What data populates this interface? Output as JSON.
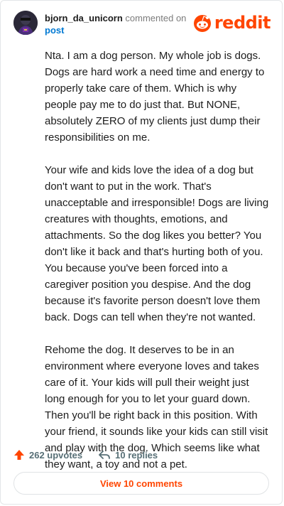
{
  "header": {
    "username": "bjorn_da_unicorn",
    "commented_text": "commented on",
    "post_link": "post",
    "logo_text": "reddit",
    "brand_color": "#ff4500",
    "link_color": "#0079d3"
  },
  "comment": {
    "paragraphs": [
      "Nta. I am a dog person. My whole job is dogs. Dogs are hard work a need time and energy to properly take care of them. Which is why people pay me to do just that. But NONE, absolutely ZERO of my clients just dump their responsibilities on me.",
      "Your wife and kids love the idea of a dog but don't want to put in the work. That's unacceptable and irresponsible! Dogs are living creatures with thoughts, emotions, and attachments. So the dog likes you better? You don't like it back and that's hurting both of you. You because you've been forced into a caregiver position you despise. And the dog because it's favorite person doesn't love them back. Dogs can tell when they're not wanted.",
      "Rehome the dog. It deserves to be in an environment where everyone loves and takes care of it. Your kids will pull their weight just long enough for you to let your guard down. Then you'll be right back in this position. With your friend, it sounds like your kids can still visit and play with the dog. Which seems like what they want, a toy and not a pet."
    ]
  },
  "actions": {
    "upvotes": "262 upvotes",
    "replies": "10 replies",
    "upvote_icon": "upvote-arrow-icon",
    "reply_icon": "reply-arrow-icon"
  },
  "footer": {
    "view_comments": "View 10 comments"
  }
}
